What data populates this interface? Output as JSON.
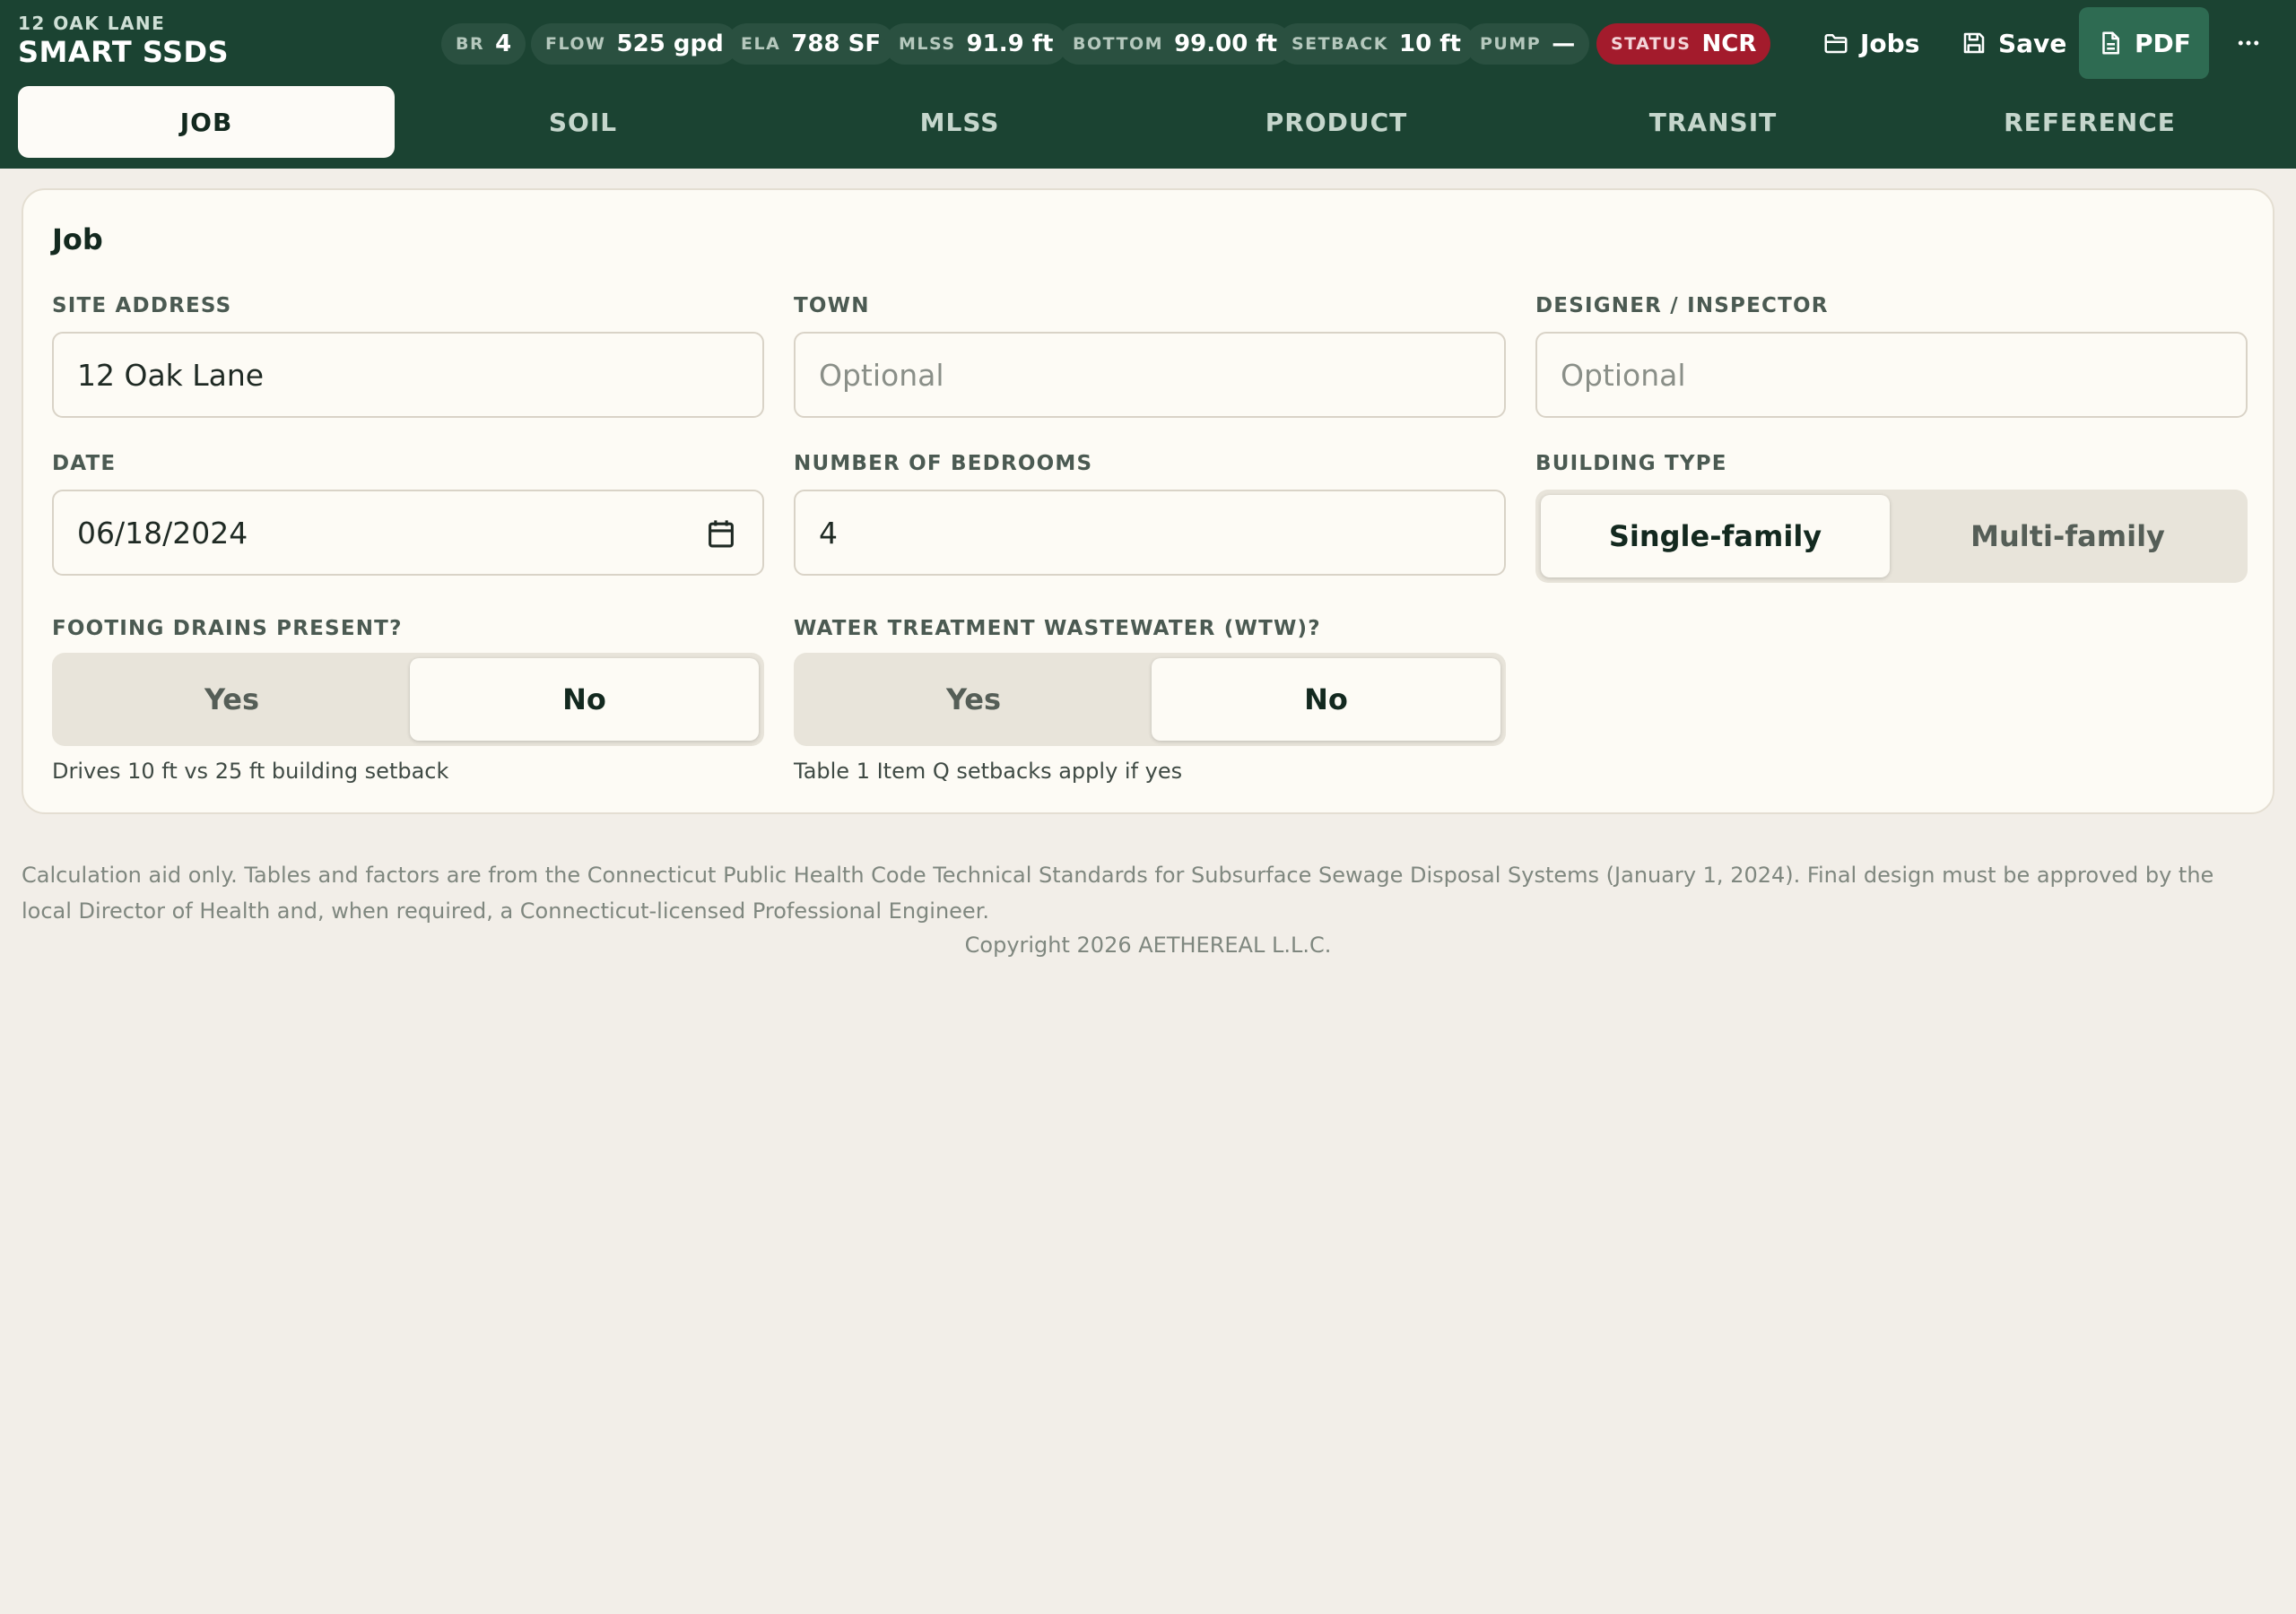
{
  "brand": {
    "subtitle": "12 OAK LANE",
    "title": "SMART SSDS"
  },
  "metrics": [
    {
      "label": "BR",
      "value": "4"
    },
    {
      "label": "FLOW",
      "value": "525 gpd"
    },
    {
      "label": "ELA",
      "value": "788 SF"
    },
    {
      "label": "MLSS",
      "value": "91.9 ft"
    },
    {
      "label": "BOTTOM",
      "value": "99.00 ft"
    },
    {
      "label": "SETBACK",
      "value": "10 ft"
    },
    {
      "label": "PUMP",
      "value": "—"
    },
    {
      "label": "STATUS",
      "value": "NCR",
      "color": "#a31b2c"
    }
  ],
  "actions": {
    "jobs": {
      "label": "Jobs",
      "icon": "folder-icon"
    },
    "save": {
      "label": "Save",
      "icon": "save-icon"
    },
    "pdf": {
      "label": "PDF",
      "icon": "document-icon"
    },
    "more": {
      "icon": "more-icon"
    }
  },
  "tabs": [
    {
      "label": "JOB",
      "active": true
    },
    {
      "label": "SOIL"
    },
    {
      "label": "MLSS"
    },
    {
      "label": "PRODUCT"
    },
    {
      "label": "TRANSIT"
    },
    {
      "label": "REFERENCE"
    }
  ],
  "job": {
    "title": "Job",
    "site_address": {
      "label": "SITE ADDRESS",
      "value": "12 Oak Lane"
    },
    "town": {
      "label": "TOWN",
      "placeholder": "Optional",
      "value": ""
    },
    "designer": {
      "label": "DESIGNER / INSPECTOR",
      "placeholder": "Optional",
      "value": ""
    },
    "date": {
      "label": "DATE",
      "value": "06/18/2024",
      "icon": "calendar-icon"
    },
    "bedrooms": {
      "label": "NUMBER OF BEDROOMS",
      "value": "4"
    },
    "building_type": {
      "label": "BUILDING TYPE",
      "options": [
        "Single-family",
        "Multi-family"
      ],
      "selected": "Single-family"
    },
    "footing_drains": {
      "label": "FOOTING DRAINS PRESENT?",
      "options": [
        "Yes",
        "No"
      ],
      "selected": "No",
      "hint": "Drives 10 ft vs 25 ft building setback"
    },
    "wtw": {
      "label": "WATER TREATMENT WASTEWATER (WTW)?",
      "options": [
        "Yes",
        "No"
      ],
      "selected": "No",
      "hint": "Table 1 Item Q setbacks apply if yes"
    }
  },
  "footer": {
    "disclaimer": "Calculation aid only. Tables and factors are from the Connecticut Public Health Code Technical Standards for Subsurface Sewage Disposal Systems (January 1, 2024). Final design must be approved by the local Director of Health and, when required, a Connecticut-licensed Professional Engineer.",
    "copyright": "Copyright 2026 AETHEREAL L.L.C."
  },
  "colors": {
    "header": "#1b4332",
    "accent": "#2e6b52",
    "status": "#a31b2c",
    "background": "#f2eee8"
  }
}
